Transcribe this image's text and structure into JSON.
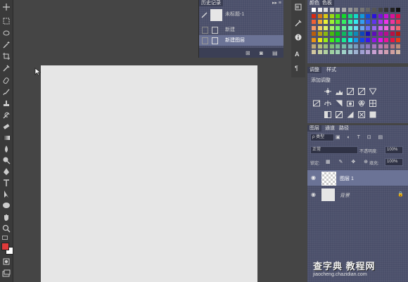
{
  "history": {
    "title": "历史记录",
    "snapshot_label": "未标题-1",
    "items": [
      {
        "label": "新建"
      },
      {
        "label": "新建图层"
      }
    ]
  },
  "swatches": {
    "tabs": [
      "颜色",
      "色板"
    ]
  },
  "adjustments": {
    "tabs": [
      "调整",
      "样式"
    ],
    "heading": "添加调整"
  },
  "layers": {
    "tabs": [
      "图层",
      "通道",
      "路径"
    ],
    "filter_label": "ρ 类型",
    "blend_mode": "正常",
    "opacity_label": "不透明度:",
    "opacity_value": "100%",
    "lock_label": "锁定:",
    "fill_label": "填充:",
    "fill_value": "100%",
    "items": [
      {
        "name": "图层 1"
      },
      {
        "name": "背景"
      }
    ]
  },
  "watermark": {
    "main": "查字典 教程网",
    "sub": "jiaocheng.chazidian.com"
  },
  "colors": {
    "foreground": "#e03a3a",
    "background": "#ffffff",
    "panel": "#4a4f6a",
    "selection": "#6b7396"
  }
}
